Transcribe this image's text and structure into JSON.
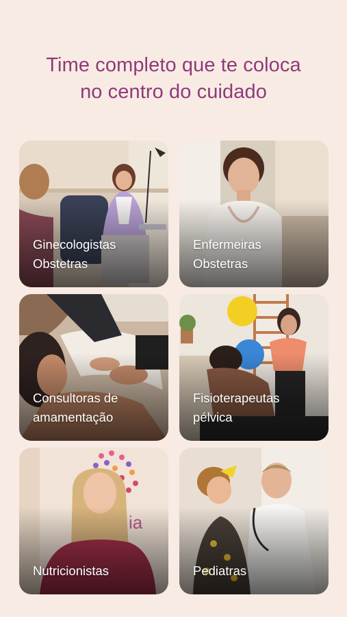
{
  "headline": {
    "line1": "Time completo que te coloca",
    "line2": "no centro do cuidado"
  },
  "colors": {
    "background": "#f8ebe3",
    "headline": "#8e3a7b",
    "card_text": "#ffffff"
  },
  "cards": [
    {
      "label": "Ginecologistas\nObstetras",
      "photo": "gynecologist-consultation-photo"
    },
    {
      "label": "Enfermeiras\nObstetras",
      "photo": "nurse-portrait-photo"
    },
    {
      "label": "Consultoras de\namamentação",
      "photo": "breastfeeding-consultant-photo"
    },
    {
      "label": "Fisioterapeutas\npélvica",
      "photo": "pelvic-physiotherapy-photo"
    },
    {
      "label": "Nutricionistas",
      "photo": "nutritionist-portrait-photo"
    },
    {
      "label": "Pediatras",
      "photo": "pediatrician-with-child-photo"
    }
  ]
}
